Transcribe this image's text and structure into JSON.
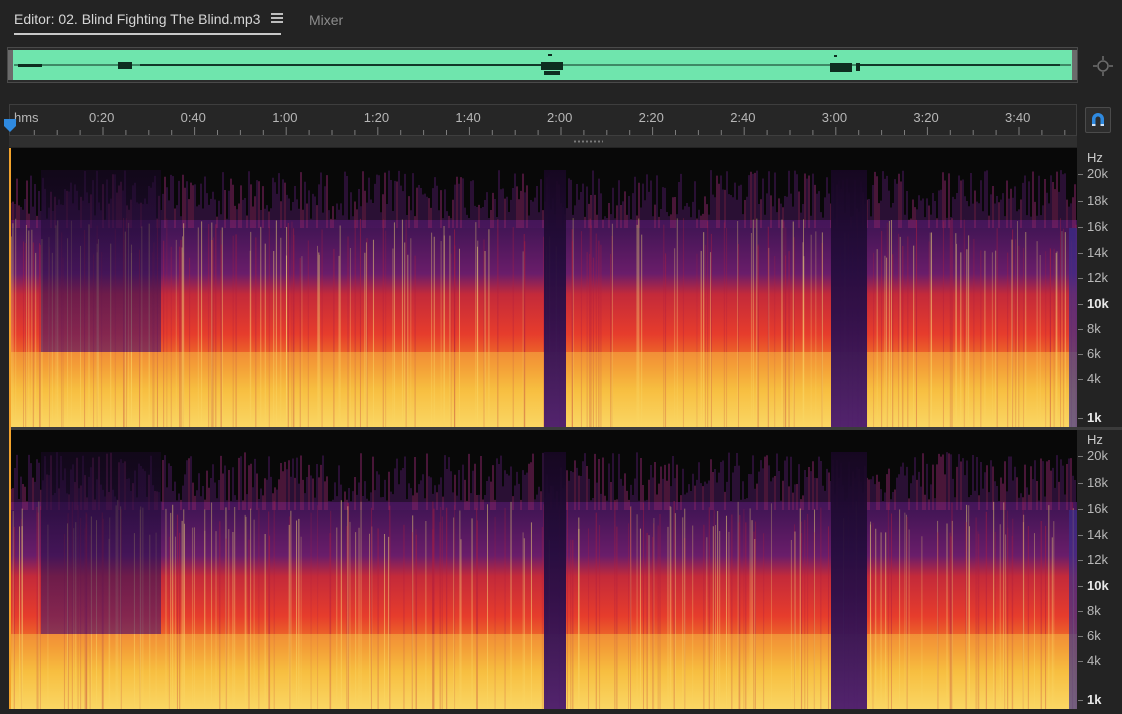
{
  "tabs": {
    "editor_label": "Editor: 02. Blind Fighting The Blind.mp3",
    "mixer_label": "Mixer"
  },
  "colors": {
    "waveform": "#6fe5ad",
    "accent": "#2f8ae0",
    "spectral_low": "#f7d34a",
    "spectral_mid": "#e63c2c",
    "spectral_high": "#6a1d6a"
  },
  "ruler": {
    "unit": "hms",
    "labels": [
      "0:20",
      "0:40",
      "1:00",
      "1:20",
      "1:40",
      "2:00",
      "2:20",
      "2:40",
      "3:00",
      "3:20",
      "3:40"
    ]
  },
  "spectral": {
    "hz_unit": "Hz",
    "ticks": [
      {
        "label": "20k",
        "major": false
      },
      {
        "label": "18k",
        "major": false
      },
      {
        "label": "16k",
        "major": false
      },
      {
        "label": "14k",
        "major": false
      },
      {
        "label": "12k",
        "major": false
      },
      {
        "label": "10k",
        "major": true
      },
      {
        "label": "8k",
        "major": false
      },
      {
        "label": "6k",
        "major": false
      },
      {
        "label": "4k",
        "major": false
      },
      {
        "label": "1k",
        "major": true
      }
    ]
  },
  "icons": {
    "panel_menu": "hamburger-icon",
    "zoom": "zoom-navigator-icon",
    "snap": "magnet-icon",
    "playhead": "playhead-marker-icon"
  }
}
